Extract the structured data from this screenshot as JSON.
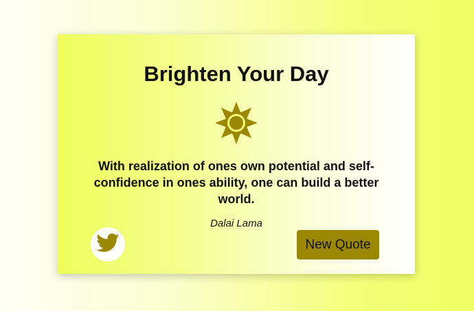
{
  "card": {
    "title": "Brighten Your Day",
    "quote_text": "With realization of ones own potential and self-confidence in ones ability, one can build a better world.",
    "author": "Dalai Lama",
    "new_quote_label": "New Quote",
    "icons": {
      "sun": "sun-icon",
      "twitter": "twitter-icon"
    }
  },
  "colors": {
    "accent": "#9c8800",
    "background_light": "#fffff5",
    "background_yellow": "#efff63"
  }
}
